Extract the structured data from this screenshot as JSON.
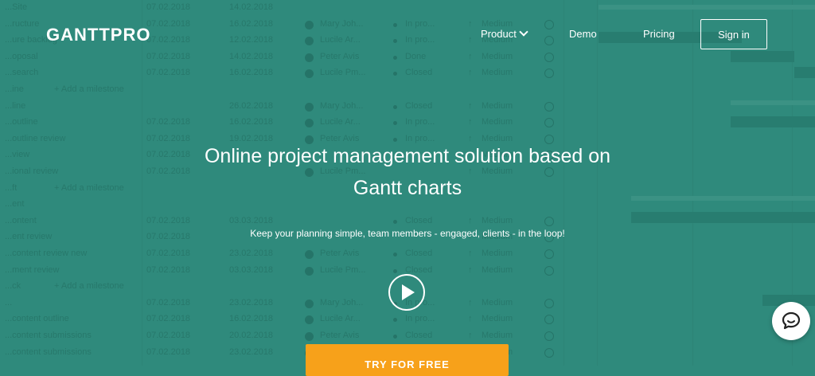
{
  "header": {
    "logo": "GANTTPRO",
    "nav": {
      "product": "Product",
      "demo": "Demo",
      "pricing": "Pricing",
      "sign_in": "Sign in"
    }
  },
  "hero": {
    "title_line1": "Online project management solution based on",
    "title_line2": "Gantt charts",
    "subtitle": "Keep your planning simple, team members - engaged, clients - in the loop!",
    "cta": "TRY FOR FREE",
    "play_icon": "play-icon"
  },
  "chat_widget": {
    "icon": "chat-icon"
  },
  "background_table": {
    "rows": [
      {
        "task": "...Site",
        "start": "07.02.2018",
        "end": "14.02.2018",
        "name": "",
        "status": "",
        "prio": ""
      },
      {
        "task": "...ructure",
        "start": "07.02.2018",
        "end": "16.02.2018",
        "name": "Mary Joh...",
        "status": "In pro...",
        "prio": "Medium"
      },
      {
        "task": "...ure backlog",
        "start": "07.02.2018",
        "end": "12.02.2018",
        "name": "Lucile Ar...",
        "status": "In pro...",
        "prio": "Medium"
      },
      {
        "task": "...oposal",
        "start": "07.02.2018",
        "end": "14.02.2018",
        "name": "Peter Avis",
        "status": "Done",
        "prio": "Medium"
      },
      {
        "task": "...search",
        "start": "07.02.2018",
        "end": "16.02.2018",
        "name": "Lucile Pm...",
        "status": "Closed",
        "prio": "Medium"
      },
      {
        "task": "...ine",
        "milestone": "+ Add a milestone",
        "start": "",
        "end": "",
        "name": "",
        "status": "",
        "prio": ""
      },
      {
        "task": "...line",
        "start": "",
        "end": "26.02.2018",
        "name": "Mary Joh...",
        "status": "Closed",
        "prio": "Medium"
      },
      {
        "task": "...outline",
        "start": "07.02.2018",
        "end": "16.02.2018",
        "name": "Lucile Ar...",
        "status": "In pro...",
        "prio": "Medium"
      },
      {
        "task": "...outline review",
        "start": "07.02.2018",
        "end": "19.02.2018",
        "name": "Peter Avis",
        "status": "In pro...",
        "prio": "Medium"
      },
      {
        "task": "...view",
        "start": "07.02.2018",
        "end": "",
        "name": "",
        "status": "",
        "prio": "Medium"
      },
      {
        "task": "...ional review",
        "start": "07.02.2018",
        "end": "",
        "name": "Lucile Pm...",
        "status": "",
        "prio": "Medium"
      },
      {
        "task": "...ft",
        "milestone": "+ Add a milestone",
        "start": "",
        "end": "",
        "name": "",
        "status": "",
        "prio": ""
      },
      {
        "task": "...ent",
        "start": "",
        "end": "",
        "name": "",
        "status": "",
        "prio": ""
      },
      {
        "task": "...ontent",
        "start": "07.02.2018",
        "end": "03.03.2018",
        "name": "",
        "status": "Closed",
        "prio": "Medium"
      },
      {
        "task": "...ent review",
        "start": "07.02.2018",
        "end": "",
        "name": "",
        "status": "",
        "prio": "Medium"
      },
      {
        "task": "...content review new",
        "start": "07.02.2018",
        "end": "23.02.2018",
        "name": "Peter Avis",
        "status": "Closed",
        "prio": "Medium"
      },
      {
        "task": "...ment review",
        "start": "07.02.2018",
        "end": "03.03.2018",
        "name": "Lucile Pm...",
        "status": "Closed",
        "prio": "Medium"
      },
      {
        "task": "...ck",
        "milestone": "+ Add a milestone",
        "start": "",
        "end": "",
        "name": "",
        "status": "",
        "prio": ""
      },
      {
        "task": "...",
        "start": "07.02.2018",
        "end": "23.02.2018",
        "name": "Mary Joh...",
        "status": "In pro...",
        "prio": "Medium"
      },
      {
        "task": "...content outline",
        "start": "07.02.2018",
        "end": "16.02.2018",
        "name": "Lucile Ar...",
        "status": "In pro...",
        "prio": "Medium"
      },
      {
        "task": "...content submissions",
        "start": "07.02.2018",
        "end": "20.02.2018",
        "name": "Peter Avis",
        "status": "Closed",
        "prio": "Medium"
      },
      {
        "task": "...content submissions",
        "start": "07.02.2018",
        "end": "23.02.2018",
        "name": "Lucile Pm...",
        "status": "Closed",
        "prio": "Medium"
      }
    ]
  },
  "colors": {
    "background": "#2f8a7c",
    "cta": "#f7a11a",
    "text": "#ffffff"
  }
}
